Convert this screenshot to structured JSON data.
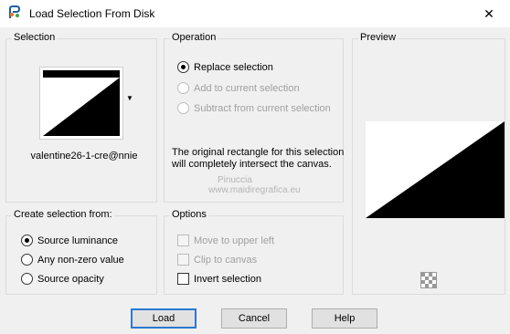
{
  "window": {
    "title": "Load Selection From Disk",
    "close_glyph": "✕",
    "icon": "app-icon"
  },
  "selection": {
    "label": "Selection",
    "name": "valentine26-1-cre@nnie",
    "dropdown_glyph": "▼"
  },
  "operation": {
    "label": "Operation",
    "options": [
      {
        "label": "Replace selection",
        "checked": true,
        "enabled": true
      },
      {
        "label": "Add to current selection",
        "checked": false,
        "enabled": false
      },
      {
        "label": "Subtract from current selection",
        "checked": false,
        "enabled": false
      }
    ],
    "info": "The original rectangle for this selection will completely intersect the canvas."
  },
  "preview": {
    "label": "Preview",
    "icon": "checkerboard-icon"
  },
  "create_from": {
    "label": "Create selection from:",
    "options": [
      {
        "label": "Source luminance",
        "checked": true
      },
      {
        "label": "Any non-zero value",
        "checked": false
      },
      {
        "label": "Source opacity",
        "checked": false
      }
    ]
  },
  "options": {
    "label": "Options",
    "items": [
      {
        "label": "Move to upper left",
        "checked": false,
        "enabled": false
      },
      {
        "label": "Clip to canvas",
        "checked": false,
        "enabled": false
      },
      {
        "label": "Invert selection",
        "checked": false,
        "enabled": true
      }
    ]
  },
  "watermark": {
    "line1": "Pinuccia",
    "line2": "www.maidiregrafica.eu"
  },
  "buttons": {
    "load": "Load",
    "cancel": "Cancel",
    "help": "Help"
  },
  "colors": {
    "accent": "#2b78d0",
    "background": "#f0f0f0"
  }
}
